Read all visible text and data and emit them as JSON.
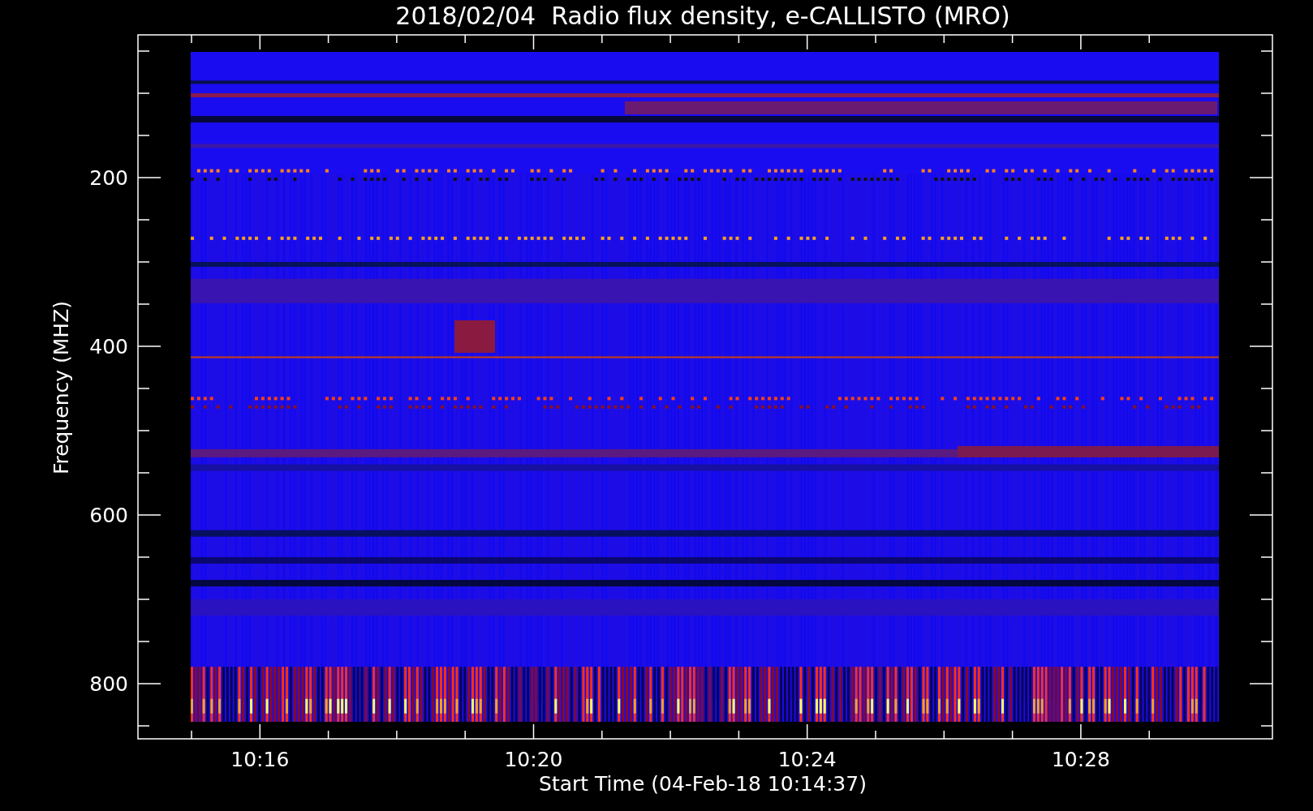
{
  "plot": {
    "title": "2018/02/04  Radio flux density, e-CALLISTO (MRO)",
    "y_axis": {
      "label": "Frequency (MHZ)",
      "ticks": [
        "200",
        "400",
        "600",
        "800"
      ]
    },
    "x_axis": {
      "label": "Start Time (04-Feb-18 10:14:37)",
      "ticks": [
        "10:16",
        "10:20",
        "10:24",
        "10:28"
      ]
    }
  }
}
